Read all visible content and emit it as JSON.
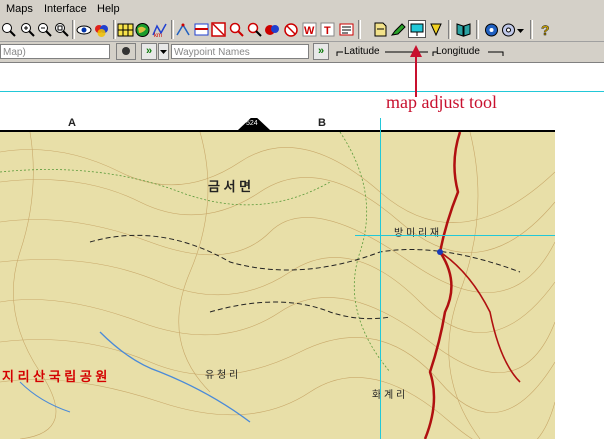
{
  "menu": {
    "items": [
      "Maps",
      "Interface",
      "Help"
    ]
  },
  "toolbar": {
    "icons": [
      "zoom-icon",
      "zoom-in-icon",
      "zoom-out-icon",
      "zoom-fit-icon",
      "eye-icon",
      "color-icon",
      "grid-icon",
      "globe-icon",
      "route-icon",
      "measure-icon",
      "tool-a-icon",
      "tool-b-icon",
      "tool-c-icon",
      "tool-d-icon",
      "tool-e-icon",
      "tool-f-icon",
      "tool-g-icon",
      "tool-h-icon",
      "save-icon",
      "edit-icon",
      "map-adjust-icon",
      "pen-icon",
      "book-icon",
      "gps-icon",
      "dropdown-icon",
      "help-icon"
    ]
  },
  "row2": {
    "map_field": "Map)",
    "waypoint_placeholder": "Waypoint Names",
    "go_label": "»",
    "latitude_label": "Latitude",
    "longitude_label": "Longitude"
  },
  "annotation": {
    "text": "map adjust tool",
    "color": "#c8102e"
  },
  "map": {
    "ruler_letters": [
      "A",
      "B"
    ],
    "ruler_number": "524",
    "place_names": [
      "금 서 면",
      "지 리 산 국 립 공 원",
      "유 청 리",
      "방 미 리 재",
      "화 계 리"
    ],
    "guide_color": "#22c8d8",
    "trail_color": "#b01010"
  }
}
